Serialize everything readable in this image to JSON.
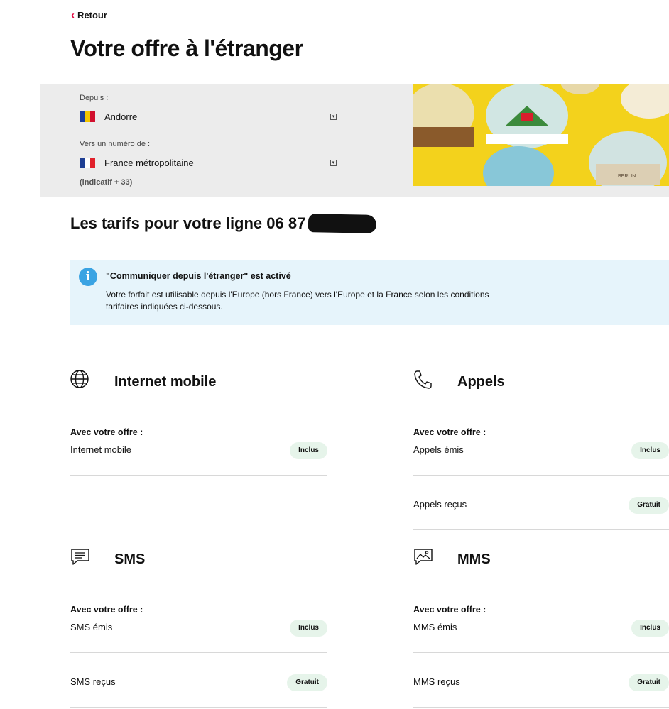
{
  "header": {
    "back_label": "Retour",
    "title": "Votre offre à l'étranger"
  },
  "selector": {
    "from_label": "Depuis :",
    "from_value": "Andorre",
    "to_label": "Vers un numéro de :",
    "to_value": "France métropolitaine",
    "dial_hint": "(indicatif + 33)",
    "hero_image_text": "BERLIN"
  },
  "rates": {
    "title": "Les tarifs pour votre ligne 06 87"
  },
  "info": {
    "title": "\"Communiquer depuis l'étranger\" est activé",
    "line1": "Votre forfait est utilisable depuis l'Europe (hors France) vers l'Europe et la France selon les conditions",
    "line2": "tarifaires indiquées ci-dessous."
  },
  "sections": {
    "internet": {
      "icon": "globe-icon",
      "title": "Internet mobile",
      "offer_label": "Avec votre offre :",
      "rows": [
        {
          "label": "Internet mobile",
          "badge": "Inclus"
        }
      ]
    },
    "calls": {
      "icon": "phone-icon",
      "title": "Appels",
      "offer_label": "Avec votre offre :",
      "rows": [
        {
          "label": "Appels émis",
          "badge": "Inclus"
        },
        {
          "label": "Appels reçus",
          "badge": "Gratuit"
        }
      ]
    },
    "sms": {
      "icon": "message-icon",
      "title": "SMS",
      "offer_label": "Avec votre offre :",
      "rows": [
        {
          "label": "SMS émis",
          "badge": "Inclus"
        },
        {
          "label": "SMS reçus",
          "badge": "Gratuit"
        }
      ]
    },
    "mms": {
      "icon": "picture-message-icon",
      "title": "MMS",
      "offer_label": "Avec votre offre :",
      "rows": [
        {
          "label": "MMS émis",
          "badge": "Inclus"
        },
        {
          "label": "MMS reçus",
          "badge": "Gratuit"
        }
      ]
    }
  },
  "colors": {
    "accent": "#e2003c",
    "info_bg": "#e6f4fb",
    "info_icon": "#3aa3e3",
    "badge_bg": "#e6f4ea",
    "panel_bg": "#ececec"
  }
}
